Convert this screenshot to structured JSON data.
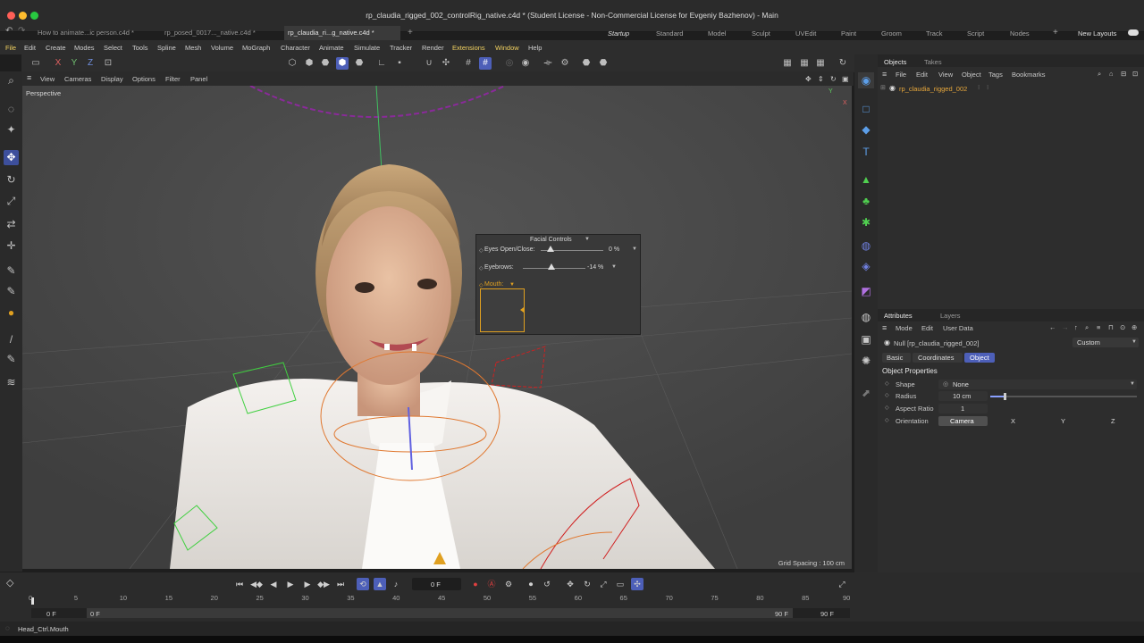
{
  "window": {
    "title": "rp_claudia_rigged_002_controlRig_native.c4d * (Student License - Non-Commercial License for Evgeniy Bazhenov) - Main",
    "doc_tabs": [
      "How to animate...ic person.c4d *",
      "rp_posed_0017..._native.c4d *",
      "rp_claudia_ri...g_native.c4d *"
    ],
    "new_tab": "+"
  },
  "layouts": [
    "Startup",
    "Standard",
    "Model",
    "Sculpt",
    "UVEdit",
    "Paint",
    "Groom",
    "Track",
    "Script",
    "Nodes"
  ],
  "layout_add": "+",
  "new_layouts": "New Layouts",
  "menus": [
    "File",
    "Edit",
    "Create",
    "Modes",
    "Select",
    "Tools",
    "Spline",
    "Mesh",
    "Volume",
    "MoGraph",
    "Character",
    "Animate",
    "Simulate",
    "Tracker",
    "Render",
    "Extensions",
    "Window",
    "Help"
  ],
  "axis_buttons": [
    "X",
    "Y",
    "Z"
  ],
  "viewport": {
    "menus": [
      "View",
      "Cameras",
      "Display",
      "Options",
      "Filter",
      "Panel"
    ],
    "label": "Perspective",
    "grid_spacing": "Grid Spacing : 100 cm",
    "axis": {
      "y": "Y",
      "x": "X"
    }
  },
  "facial_controls": {
    "title": "Facial Controls",
    "eyes_label": "Eyes Open/Close:",
    "eyes_value": "0 %",
    "eyes_fraction": 0.15,
    "eyebrows_label": "Eyebrows:",
    "eyebrows_value": "-14 %",
    "eyebrows_fraction": 0.45,
    "mouth_label": "Mouth:"
  },
  "object_manager": {
    "tabs": [
      "Objects",
      "Takes"
    ],
    "menus": [
      "File",
      "Edit",
      "View",
      "Object",
      "Tags",
      "Bookmarks"
    ],
    "items": [
      {
        "name": "rp_claudia_rigged_002"
      }
    ]
  },
  "attributes": {
    "tabs": [
      "Attributes",
      "Layers"
    ],
    "menus": [
      "Mode",
      "Edit",
      "User Data"
    ],
    "object_title": "Null [rp_claudia_rigged_002]",
    "preset": "Custom",
    "subtabs": [
      "Basic",
      "Coordinates",
      "Object"
    ],
    "section": "Object Properties",
    "shape_label": "Shape",
    "shape_value": "None",
    "radius_label": "Radius",
    "radius_value": "10 cm",
    "aspect_label": "Aspect Ratio",
    "aspect_value": "1",
    "orientation_label": "Orientation",
    "orientation_values": [
      "Camera",
      "X",
      "Y",
      "Z"
    ]
  },
  "timeline": {
    "current_frame": "0 F",
    "ticks": [
      "0",
      "5",
      "10",
      "15",
      "20",
      "25",
      "30",
      "35",
      "40",
      "45",
      "50",
      "55",
      "60",
      "65",
      "70",
      "75",
      "80",
      "85",
      "90"
    ],
    "start": "0 F",
    "min": "0 F",
    "max": "90 F",
    "end": "90 F"
  },
  "status": "Head_Ctrl.Mouth",
  "colors": {
    "accent": "#4d5fb8",
    "selection_orange": "#e0a020",
    "object_highlight": "#e8a83c"
  }
}
